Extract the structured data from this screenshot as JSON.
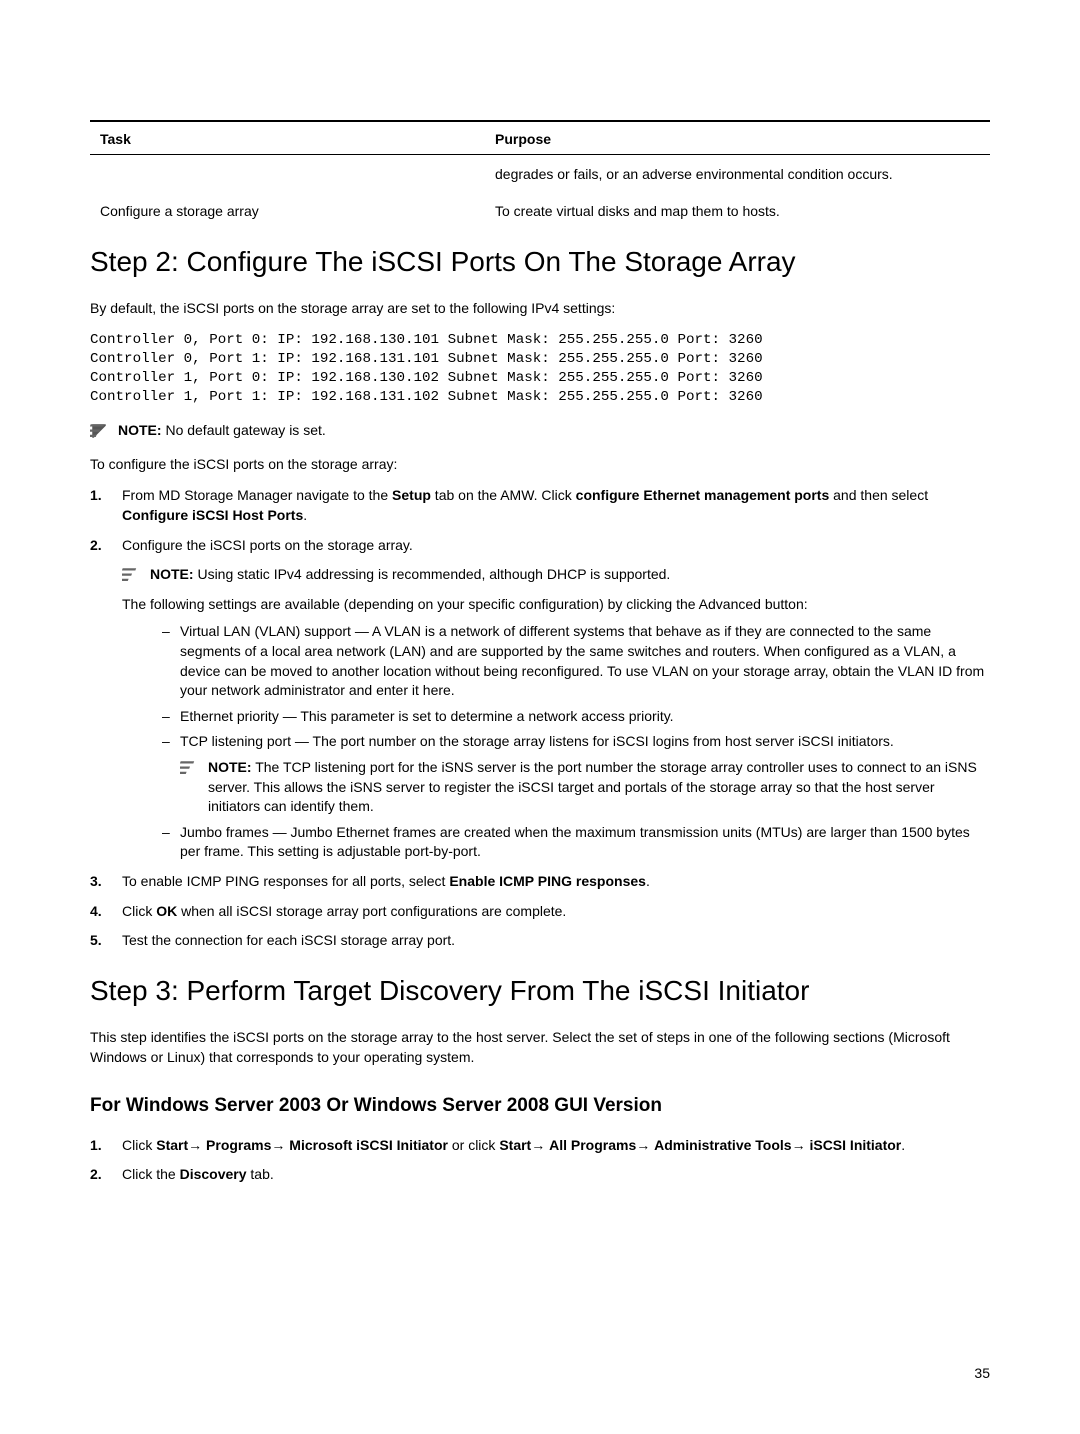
{
  "table": {
    "headers": {
      "task": "Task",
      "purpose": "Purpose"
    },
    "rows": [
      {
        "task": "",
        "purpose": "degrades or fails, or an adverse environmental condition occurs."
      },
      {
        "task": "Configure a storage array",
        "purpose": "To create virtual disks and map them to hosts."
      }
    ]
  },
  "section1": {
    "title": "Step 2: Configure The iSCSI Ports On The Storage Array",
    "intro": "By default, the iSCSI ports on the storage array are set to the following IPv4 settings:",
    "code": "Controller 0, Port 0: IP: 192.168.130.101 Subnet Mask: 255.255.255.0 Port: 3260\nController 0, Port 1: IP: 192.168.131.101 Subnet Mask: 255.255.255.0 Port: 3260\nController 1, Port 0: IP: 192.168.130.102 Subnet Mask: 255.255.255.0 Port: 3260\nController 1, Port 1: IP: 192.168.131.102 Subnet Mask: 255.255.255.0 Port: 3260",
    "note_top_label": "NOTE:",
    "note_top_text": " No default gateway is set.",
    "lead": "To configure the iSCSI ports on the storage array:",
    "step1_a": "From MD Storage Manager navigate to the ",
    "step1_b": "Setup",
    "step1_c": " tab on the AMW. Click ",
    "step1_d": "configure Ethernet management ports",
    "step1_e": " and then select ",
    "step1_f": "Configure iSCSI Host Ports",
    "step1_g": ".",
    "step2": "Configure the iSCSI ports on the storage array.",
    "step2_note_label": "NOTE:",
    "step2_note_text": " Using static IPv4 addressing is recommended, although DHCP is supported.",
    "step2_body": "The following settings are available (depending on your specific configuration) by clicking the Advanced button:",
    "sub1": "Virtual LAN (VLAN) support — A VLAN is a network of different systems that behave as if they are connected to the same segments of a local area network (LAN) and are supported by the same switches and routers. When configured as a VLAN, a device can be moved to another location without being reconfigured. To use VLAN on your storage array, obtain the VLAN ID from your network administrator and enter it here.",
    "sub2": "Ethernet priority — This parameter is set to determine a network access priority.",
    "sub3": "TCP listening port — The port number on the storage array listens for iSCSI logins from host server iSCSI initiators.",
    "sub3_note_label": "NOTE:",
    "sub3_note_text": " The TCP listening port for the iSNS server is the port number the storage array controller uses to connect to an iSNS server. This allows the iSNS server to register the iSCSI target and portals of the storage array so that the host server initiators can identify them.",
    "sub4": "Jumbo frames — Jumbo Ethernet frames are created when the maximum transmission units (MTUs) are larger than 1500 bytes per frame. This setting is adjustable port-by-port.",
    "step3_a": "To enable ICMP PING responses for all ports, select ",
    "step3_b": "Enable ICMP PING responses",
    "step3_c": ".",
    "step4_a": "Click ",
    "step4_b": "OK",
    "step4_c": " when all iSCSI storage array port configurations are complete.",
    "step5": "Test the connection for each iSCSI storage array port."
  },
  "section2": {
    "title": "Step 3: Perform Target Discovery From The iSCSI Initiator",
    "intro": "This step identifies the iSCSI ports on the storage array to the host server. Select the set of steps in one of the following sections (Microsoft Windows or Linux) that corresponds to your operating system.",
    "subsection": "For Windows Server 2003 Or Windows Server 2008 GUI Version",
    "step1_a": "Click ",
    "step1_b": "Start",
    "step1_c": "→ ",
    "step1_d": "Programs",
    "step1_e": "→ ",
    "step1_f": "Microsoft iSCSI Initiator",
    "step1_g": " or click ",
    "step1_h": "Start",
    "step1_i": "→ ",
    "step1_j": "All Programs",
    "step1_k": "→ ",
    "step1_l": "Administrative Tools",
    "step1_m": "→ ",
    "step1_n": "iSCSI Initiator",
    "step1_o": ".",
    "step2_a": "Click the ",
    "step2_b": "Discovery",
    "step2_c": " tab."
  },
  "page_num": "35"
}
